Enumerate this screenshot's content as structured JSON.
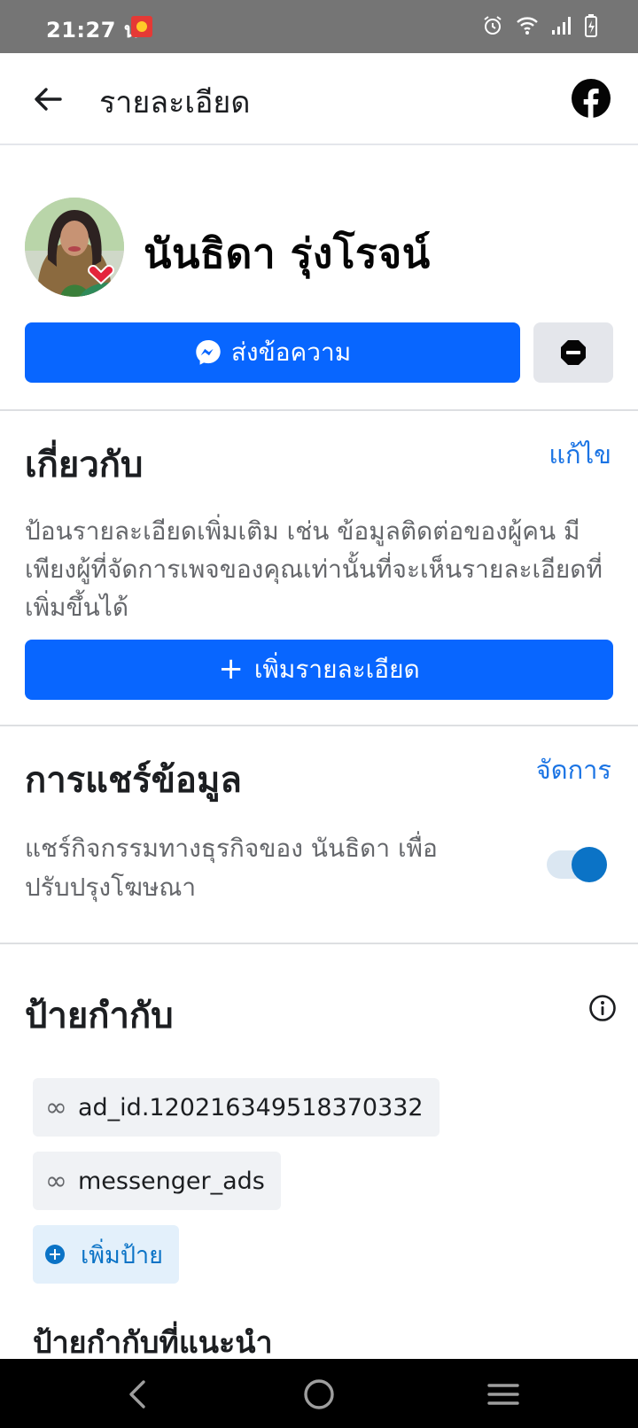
{
  "status_bar": {
    "time": "21:27 น."
  },
  "app_bar": {
    "title": "รายละเอียด"
  },
  "profile": {
    "name": "นันธิดา รุ่งโรจน์",
    "message_button": "ส่งข้อความ"
  },
  "about": {
    "title": "เกี่ยวกับ",
    "edit_link": "แก้ไข",
    "description": "ป้อนรายละเอียดเพิ่มเติม เช่น ข้อมูลติดต่อของผู้คน มีเพียงผู้ที่จัดการเพจของคุณเท่านั้นที่จะเห็นรายละเอียดที่เพิ่มขึ้นได้",
    "add_button": "เพิ่มรายละเอียด"
  },
  "data_sharing": {
    "title": "การแชร์ข้อมูล",
    "manage_link": "จัดการ",
    "description": "แชร์กิจกรรมทางธุรกิจของ นันธิดา เพื่อปรับปรุงโฆษณา",
    "toggle_on": true
  },
  "labels": {
    "title": "ป้ายกำกับ",
    "items": [
      {
        "text": "ad_id.120216349518370332"
      },
      {
        "text": "messenger_ads"
      }
    ],
    "add_label": "เพิ่มป้าย",
    "suggested_title": "ป้ายกำกับที่แนะนำ"
  },
  "colors": {
    "primary_button": "#0866ff",
    "link": "#1b74e4",
    "toggle_on": "#0b73c6"
  }
}
